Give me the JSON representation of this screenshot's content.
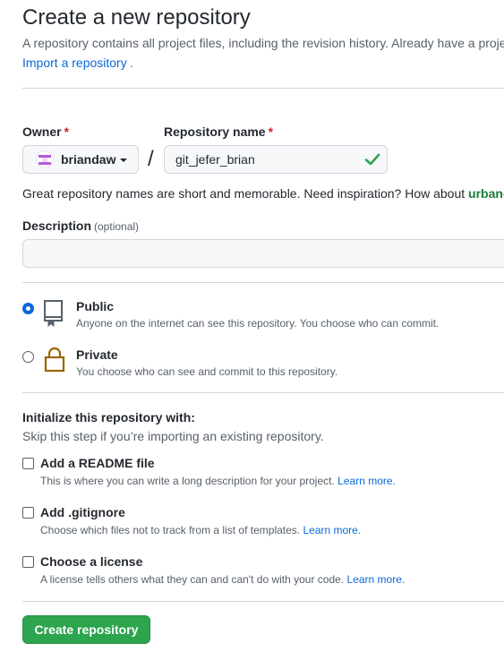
{
  "header": {
    "title": "Create a new repository",
    "subtitle": "A repository contains all project files, including the revision history. Already have a proje",
    "import_link": "Import a repository",
    "import_suffix": "."
  },
  "owner": {
    "label": "Owner",
    "required_mark": "*",
    "selected": "briandaw"
  },
  "repo_name": {
    "label": "Repository name",
    "required_mark": "*",
    "value": "git_jefer_brian",
    "separator": "/"
  },
  "hint": {
    "text": "Great repository names are short and memorable. Need inspiration? How about ",
    "suggestion": "urban-"
  },
  "description": {
    "label": "Description",
    "optional": "(optional)",
    "value": "",
    "placeholder": ""
  },
  "visibility": {
    "selected": "public",
    "options": [
      {
        "title": "Public",
        "description": "Anyone on the internet can see this repository. You choose who can commit.",
        "icon": "repo-icon"
      },
      {
        "title": "Private",
        "description": "You choose who can see and commit to this repository.",
        "icon": "lock-icon"
      }
    ]
  },
  "initialize": {
    "heading": "Initialize this repository with:",
    "subheading": "Skip this step if you’re importing an existing repository.",
    "items": [
      {
        "title": "Add a README file",
        "description": "This is where you can write a long description for your project.",
        "link": "Learn more.",
        "checked": false
      },
      {
        "title": "Add .gitignore",
        "description": "Choose which files not to track from a list of templates.",
        "link": "Learn more.",
        "checked": false
      },
      {
        "title": "Choose a license",
        "description": "A license tells others what they can and can't do with your code.",
        "link": "Learn more.",
        "checked": false
      }
    ]
  },
  "submit": {
    "label": "Create repository"
  },
  "colors": {
    "primary_button": "#2da44e",
    "link": "#0969da",
    "required": "#cf222e",
    "valid_check": "#2da44e",
    "suggestion": "#1a7f37",
    "lock_icon": "#9a6700"
  }
}
